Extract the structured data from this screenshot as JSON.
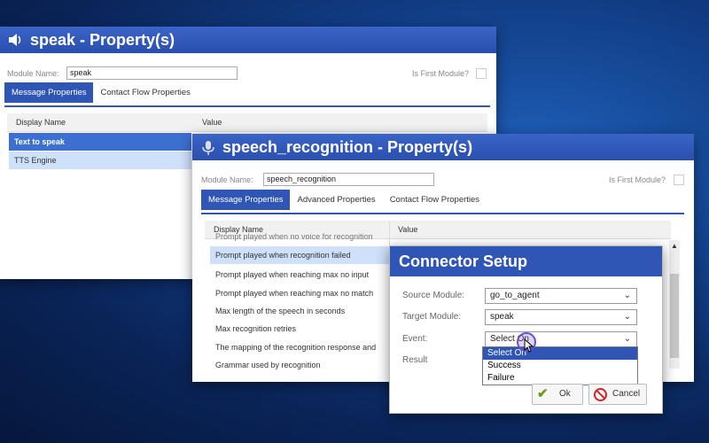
{
  "speak_window": {
    "title": "speak - Property(s)",
    "module_name_label": "Module Name:",
    "module_name_value": "speak",
    "is_first_label": "Is First Module?",
    "tabs": [
      "Message Properties",
      "Contact Flow Properties"
    ],
    "columns": [
      "Display Name",
      "Value"
    ],
    "rows": [
      "Text to speak",
      "TTS Engine"
    ]
  },
  "speech_window": {
    "title": "speech_recognition - Property(s)",
    "module_name_label": "Module Name:",
    "module_name_value": "speech_recognition",
    "is_first_label": "Is First Module?",
    "tabs": [
      "Message Properties",
      "Advanced Properties",
      "Contact Flow Properties"
    ],
    "columns": [
      "Display Name",
      "Value"
    ],
    "rows": [
      "Prompt played when no voice for recognition",
      "Prompt played when recognition failed",
      "Prompt played when reaching max no input",
      "Prompt played when reaching max no match",
      "Max length of the speech in seconds",
      "Max recognition retries",
      "The mapping of the recognition response and",
      "Grammar used by recognition"
    ]
  },
  "connector": {
    "title": "Connector Setup",
    "source_label": "Source Module:",
    "source_value": "go_to_agent",
    "target_label": "Target Module:",
    "target_value": "speak",
    "event_label": "Event:",
    "event_value": "Select On",
    "result_label": "Result",
    "event_options": [
      "Select On",
      "Success",
      "Failure"
    ],
    "ok_label": "Ok",
    "cancel_label": "Cancel"
  },
  "colors": {
    "accent": "#2f56b4",
    "title_bar": "#3a64c8",
    "selection": "#3d6fd0"
  },
  "icons": [
    "speaker-icon",
    "mic-icon",
    "chevron-down-icon",
    "checkmark-icon",
    "cancel-icon",
    "cursor-icon",
    "scroll-up-icon"
  ]
}
